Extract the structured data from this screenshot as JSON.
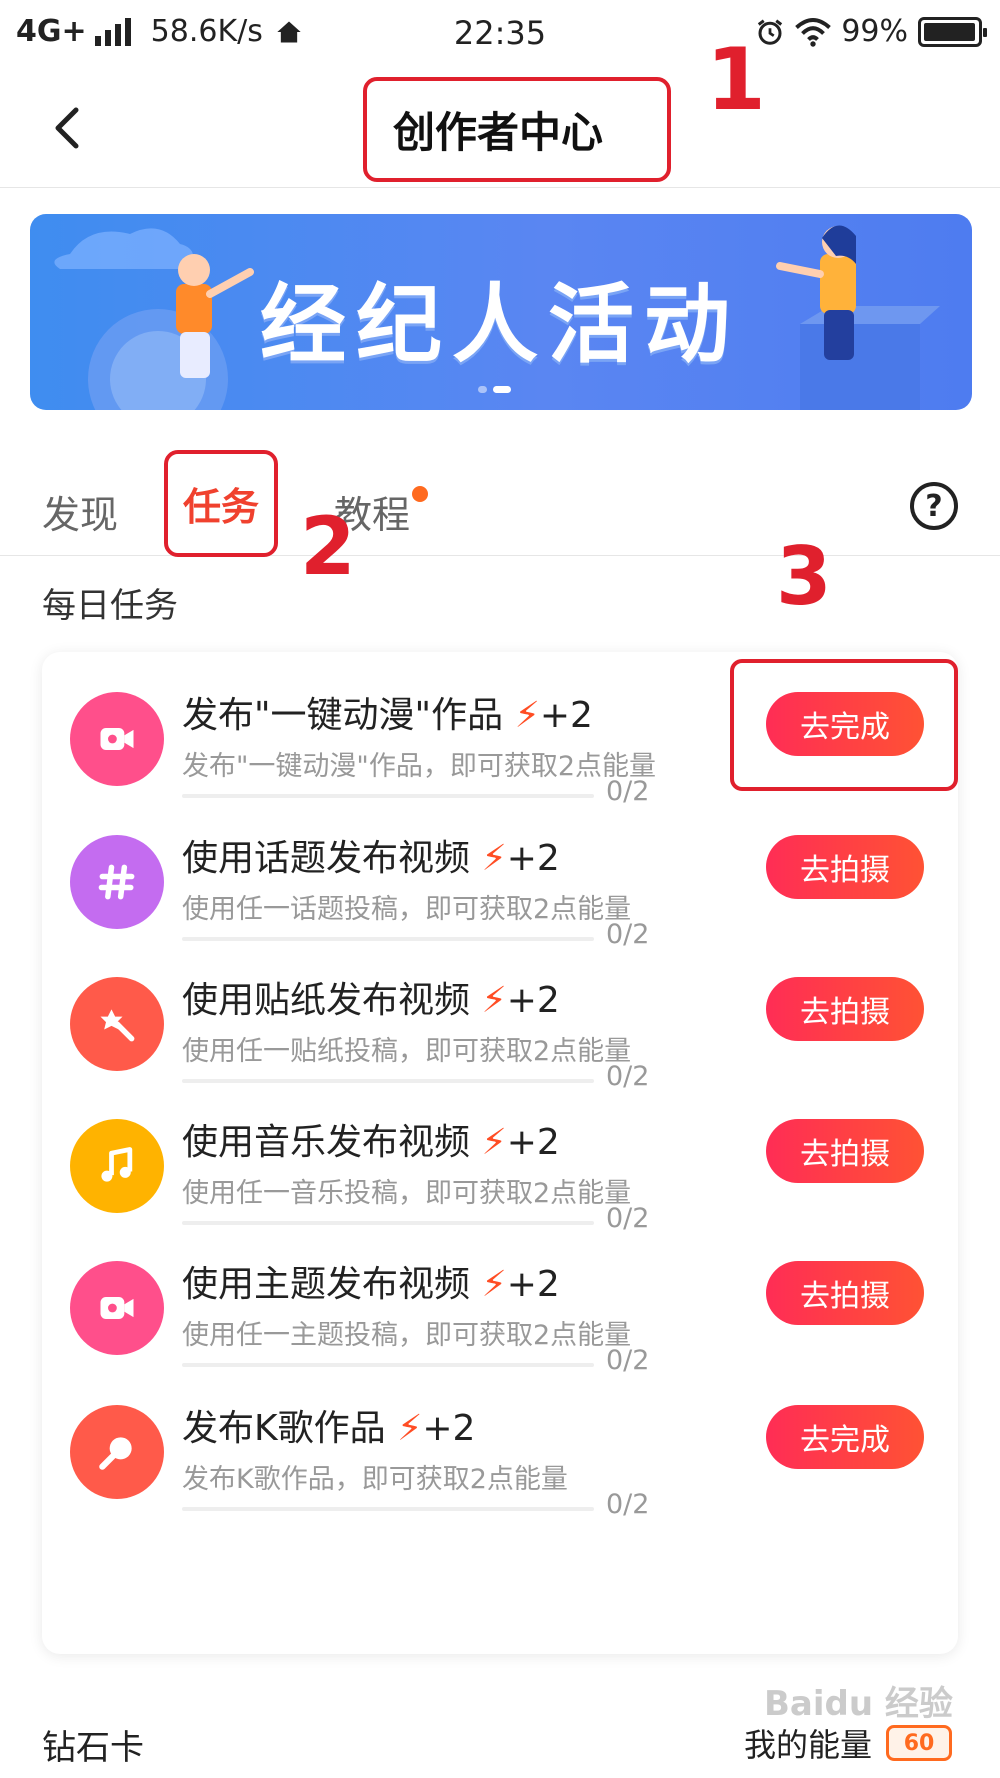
{
  "status_bar": {
    "network": "4G+",
    "speed": "58.6K/s",
    "time": "22:35",
    "battery": "99%",
    "battery_level": 0.99
  },
  "header": {
    "title": "创作者中心"
  },
  "annotations": [
    "1",
    "2",
    "3"
  ],
  "banner": {
    "title": "经纪人活动",
    "page_count": 2,
    "active_index": 1
  },
  "tabs": [
    {
      "label": "发现",
      "active": false
    },
    {
      "label": "任务",
      "active": true
    },
    {
      "label": "教程",
      "active": false,
      "badge_dot": true
    }
  ],
  "help_label": "?",
  "section": {
    "title": "每日任务"
  },
  "tasks": [
    {
      "title": "发布\"一键动漫\"作品",
      "reward": "+2",
      "desc": "发布\"一键动漫\"作品，即可获取2点能量",
      "progress": "0/2",
      "progress_fraction": 0,
      "button": "去完成",
      "icon": "video-camera-icon",
      "icon_color": "#ff4f8b"
    },
    {
      "title": "使用话题发布视频",
      "reward": "+2",
      "desc": "使用任一话题投稿，即可获取2点能量",
      "progress": "0/2",
      "progress_fraction": 0,
      "button": "去拍摄",
      "icon": "hashtag-icon",
      "icon_color": "#c46cf0"
    },
    {
      "title": "使用贴纸发布视频",
      "reward": "+2",
      "desc": "使用任一贴纸投稿，即可获取2点能量",
      "progress": "0/2",
      "progress_fraction": 0,
      "button": "去拍摄",
      "icon": "sticker-wand-icon",
      "icon_color": "#ff5a4a"
    },
    {
      "title": "使用音乐发布视频",
      "reward": "+2",
      "desc": "使用任一音乐投稿，即可获取2点能量",
      "progress": "0/2",
      "progress_fraction": 0,
      "button": "去拍摄",
      "icon": "music-note-icon",
      "icon_color": "#ffb300"
    },
    {
      "title": "使用主题发布视频",
      "reward": "+2",
      "desc": "使用任一主题投稿，即可获取2点能量",
      "progress": "0/2",
      "progress_fraction": 0,
      "button": "去拍摄",
      "icon": "video-camera-icon",
      "icon_color": "#ff4f8b"
    },
    {
      "title": "发布K歌作品",
      "reward": "+2",
      "desc": "发布K歌作品，即可获取2点能量",
      "progress": "0/2",
      "progress_fraction": 0,
      "button": "去完成",
      "icon": "microphone-icon",
      "icon_color": "#ff5a4a"
    }
  ],
  "bottom": {
    "left_label": "钻石卡",
    "right_label": "我的能量",
    "energy_value": "60"
  },
  "watermark": "Baidu 经验"
}
